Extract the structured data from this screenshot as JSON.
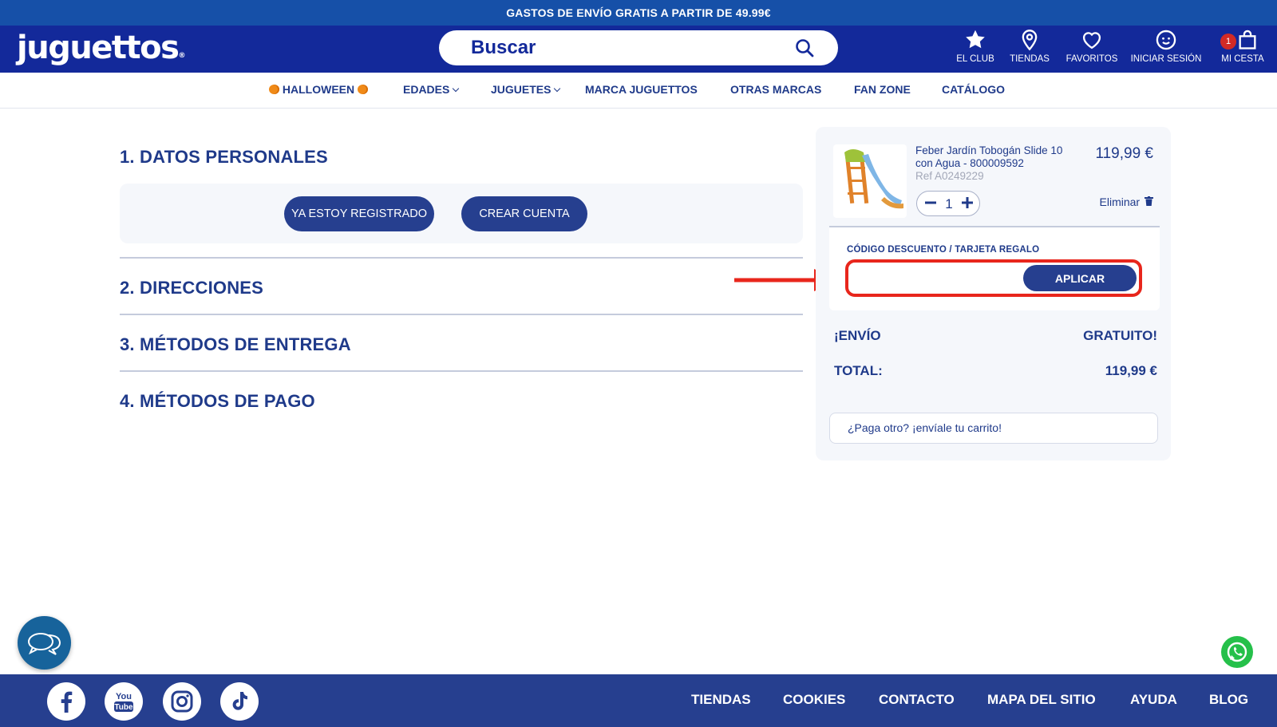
{
  "promo_banner": "GASTOS DE ENVÍO GRATIS A PARTIR DE 49.99€",
  "header": {
    "logo": "juguettos",
    "logo_mark": "®",
    "search_placeholder": "Buscar",
    "nav": {
      "club": "EL CLUB",
      "stores": "TIENDAS",
      "favorites": "FAVORITOS",
      "login": "INICIAR SESIÓN",
      "cart": "MI CESTA",
      "cart_count": "1"
    }
  },
  "category_nav": {
    "halloween": "HALLOWEEN",
    "ages": "EDADES",
    "toys": "JUGUETES",
    "brand": "MARCA JUGUETTOS",
    "other_brands": "OTRAS MARCAS",
    "fan_zone": "FAN ZONE",
    "catalog": "CATÁLOGO"
  },
  "checkout": {
    "step1": "1. DATOS PERSONALES",
    "registered_button": "YA ESTOY REGISTRADO",
    "create_account_button": "CREAR CUENTA",
    "step2": "2. DIRECCIONES",
    "step3": "3. MÉTODOS DE ENTREGA",
    "step4": "4. MÉTODOS DE PAGO"
  },
  "cart": {
    "product_name": "Feber Jardín Tobogán Slide 10 con Agua - 800009592",
    "product_ref": "Ref A0249229",
    "product_price": "119,99 €",
    "quantity": "1",
    "remove_label": "Eliminar",
    "coupon_label": "CÓDIGO DESCUENTO / TARJETA REGALO",
    "coupon_value": "",
    "apply_button": "APLICAR",
    "shipping_label": "¡ENVÍO",
    "shipping_value": "GRATUITO!",
    "total_label": "TOTAL:",
    "total_value": "119,99 €",
    "share_cart": "¿Paga otro? ¡envíale tu carrito!"
  },
  "footer": {
    "links": [
      "TIENDAS",
      "COOKIES",
      "CONTACTO",
      "MAPA DEL SITIO",
      "AYUDA",
      "BLOG"
    ],
    "social": [
      "facebook-icon",
      "youtube-icon",
      "instagram-icon",
      "tiktok-icon"
    ],
    "youtube_you": "You",
    "youtube_tube": "Tube"
  },
  "colors": {
    "brand_navy": "#13299a",
    "button_navy": "#263f8f",
    "promo_blue": "#1650a8",
    "highlight_red": "#e8261c",
    "badge_red": "#d22a25"
  }
}
